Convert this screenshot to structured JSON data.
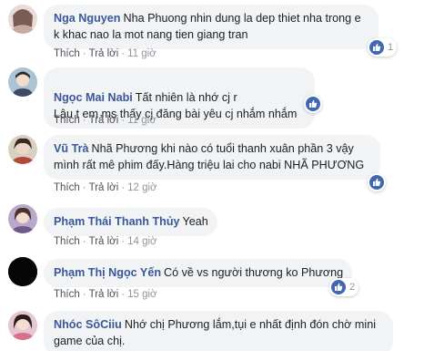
{
  "labels": {
    "like": "Thích",
    "reply": "Trả lời",
    "separator": "·"
  },
  "colors": {
    "author": "#385898",
    "bubble": "#f2f3f5",
    "like_badge": "#4267b2",
    "meta": "#90949c"
  },
  "comments": [
    {
      "avatar": "avatar-nga",
      "author": "Nga Nguyen",
      "text": "Nha Phuong nhin dung la dep thiet nha trong e k khac nao la mot nang tien giang tran",
      "time": "11 giờ",
      "like_count": "1"
    },
    {
      "avatar": "avatar-mai",
      "author": "Ngọc Mai Nabi",
      "text": "Tất nhiên là nhớ cj r\nLâu t em ms thấy cj đăng bài yêu cj nhắm nhắm",
      "time": "11 giờ",
      "like_count": ""
    },
    {
      "avatar": "avatar-tra",
      "author": "Vũ Trà",
      "text": "Nhã Phương khi nào có tuổi thanh xuân phần 3 vậy mình rất mê phim đấy.Hàng triệu lai cho nabi NHÃ PHƯƠNG",
      "time": "12 giờ",
      "like_count": ""
    },
    {
      "avatar": "avatar-thuy",
      "author": "Phạm Thái Thanh Thủy",
      "text": "Yeah",
      "time": "14 giờ",
      "like_count": ""
    },
    {
      "avatar": "avatar-yen",
      "author": "Phạm Thị Ngọc Yến",
      "text": "Có về vs người thương ko Phương",
      "time": "15 giờ",
      "like_count": "2"
    },
    {
      "avatar": "avatar-nhoc",
      "author": "Nhóc SôCiiu",
      "text": "Nhớ chị Phương lắm,tụi e nhất định đón chờ mini game của chị.",
      "time": "",
      "like_count": ""
    }
  ]
}
